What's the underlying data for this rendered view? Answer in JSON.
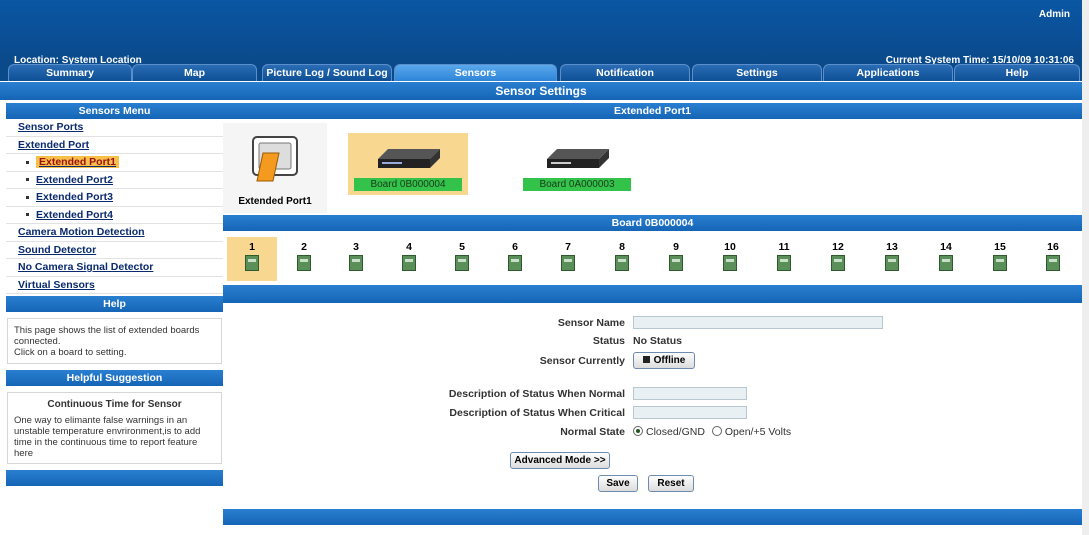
{
  "header": {
    "user": "Admin",
    "location": "Location: System Location",
    "system_time": "Current System Time: 15/10/09 10:31:06"
  },
  "tabs": [
    {
      "label": "Summary"
    },
    {
      "label": "Map"
    },
    {
      "label": "Picture Log / Sound Log"
    },
    {
      "label": "Sensors"
    },
    {
      "label": "Notification"
    },
    {
      "label": "Settings"
    },
    {
      "label": "Applications"
    },
    {
      "label": "Help"
    }
  ],
  "page_title": "Sensor Settings",
  "sidebar": {
    "menu_title": "Sensors Menu",
    "items": [
      {
        "label": "Sensor Ports"
      },
      {
        "label": "Extended Port"
      },
      {
        "label": "Extended Port1"
      },
      {
        "label": "Extended Port2"
      },
      {
        "label": "Extended Port3"
      },
      {
        "label": "Extended Port4"
      },
      {
        "label": "Camera Motion Detection"
      },
      {
        "label": "Sound Detector"
      },
      {
        "label": "No Camera Signal Detector"
      },
      {
        "label": "Virtual Sensors"
      }
    ],
    "help_title": "Help",
    "help_text_1": "This page shows the list of extended boards connected.",
    "help_text_2": "Click on a board to setting.",
    "suggestion_title": "Helpful Suggestion",
    "suggestion_heading": "Continuous Time for Sensor",
    "suggestion_text": "One way to elimante false warnings in an unstable temperature envrironment,is to add time in the continuous time to report feature here"
  },
  "main": {
    "section_title": "Extended Port1",
    "port_label": "Extended Port1",
    "boards": [
      {
        "label": "Board 0B000004"
      },
      {
        "label": "Board 0A000003"
      }
    ],
    "board_title": "Board 0B000004",
    "slots": [
      "1",
      "2",
      "3",
      "4",
      "5",
      "6",
      "7",
      "8",
      "9",
      "10",
      "11",
      "12",
      "13",
      "14",
      "15",
      "16"
    ],
    "form": {
      "sensor_name_label": "Sensor Name",
      "sensor_name_value": "",
      "status_label": "Status",
      "status_value": "No Status",
      "sensor_currently_label": "Sensor Currently",
      "sensor_currently_value": "Offline",
      "desc_normal_label": "Description of Status When Normal",
      "desc_critical_label": "Description of Status When Critical",
      "normal_state_label": "Normal State",
      "normal_state_options": [
        "Closed/GND",
        "Open/+5 Volts"
      ],
      "advanced_button": "Advanced Mode >>",
      "save_button": "Save",
      "reset_button": "Reset"
    }
  }
}
